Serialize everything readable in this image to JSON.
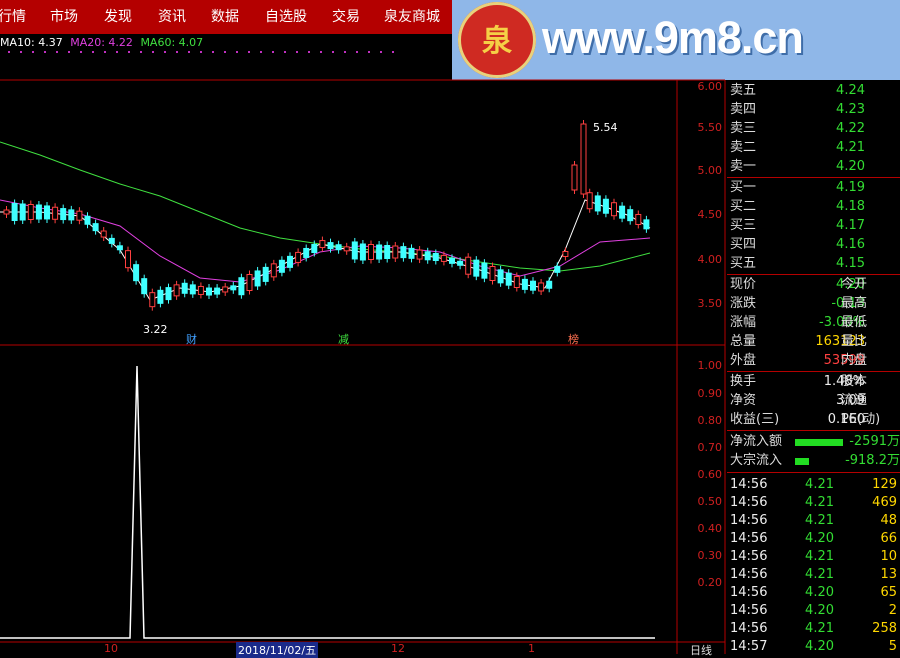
{
  "menu": [
    "行情",
    "市场",
    "发现",
    "资讯",
    "数据",
    "自选股",
    "交易",
    "泉友商城"
  ],
  "logo": {
    "badge": "泉",
    "url": "www.9m8.cn",
    "small": "www.9m8.cn"
  },
  "ma": {
    "ma10": "MA10: 4.37",
    "ma20": "MA20: 4.22",
    "ma60": "MA60: 4.07"
  },
  "price_axis": [
    "6.00",
    "5.50",
    "5.00",
    "4.50",
    "4.00",
    "3.50"
  ],
  "indicator_axis": [
    "1.00",
    "0.90",
    "0.80",
    "0.70",
    "0.60",
    "0.50",
    "0.40",
    "0.30",
    "0.20"
  ],
  "chart_labels": {
    "high": "5.54",
    "low": "3.22",
    "cai": "财",
    "jian": "减",
    "bang": "榜"
  },
  "date_axis": {
    "m10": "10",
    "date": "2018/11/02/五",
    "m12": "12",
    "m1": "1",
    "period": "日线"
  },
  "colors": {
    "up": "#ff4040",
    "down": "#40ffff",
    "ma10": "#ffffff",
    "ma20": "#e040e0",
    "ma60": "#40e040"
  },
  "chart_data": {
    "type": "line",
    "title": "",
    "series": [
      {
        "name": "MA10",
        "values": [
          4.37
        ]
      },
      {
        "name": "MA20",
        "values": [
          4.22
        ]
      },
      {
        "name": "MA60",
        "values": [
          4.07
        ]
      }
    ],
    "annotations": [
      "5.54",
      "3.22"
    ],
    "ylim": [
      3.3,
      6.0
    ]
  },
  "orderbook": {
    "asks": [
      {
        "label": "卖五",
        "price": "4.24"
      },
      {
        "label": "卖四",
        "price": "4.23"
      },
      {
        "label": "卖三",
        "price": "4.22"
      },
      {
        "label": "卖二",
        "price": "4.21"
      },
      {
        "label": "卖一",
        "price": "4.20"
      }
    ],
    "bids": [
      {
        "label": "买一",
        "price": "4.19"
      },
      {
        "label": "买二",
        "price": "4.18"
      },
      {
        "label": "买三",
        "price": "4.17"
      },
      {
        "label": "买四",
        "price": "4.16"
      },
      {
        "label": "买五",
        "price": "4.15"
      }
    ]
  },
  "stats": [
    {
      "l": "现价",
      "v": "4.20",
      "r": "今开"
    },
    {
      "l": "涨跌",
      "v": "-0.13",
      "r": "最高"
    },
    {
      "l": "涨幅",
      "v": "-3.00%",
      "r": "最低"
    },
    {
      "l": "总量",
      "v": "163123",
      "r": "量比"
    },
    {
      "l": "外盘",
      "v": "53599",
      "r": "内盘"
    },
    {
      "l": "换手",
      "v": "1.48%",
      "r": "股本"
    },
    {
      "l": "净资",
      "v": "3.09",
      "r": "流通"
    },
    {
      "l": "收益(三)",
      "v": "0.160",
      "r": "PE(动)"
    }
  ],
  "flows": [
    {
      "l": "净流入额",
      "v": "-2591万"
    },
    {
      "l": "大宗流入",
      "v": "-918.2万"
    }
  ],
  "trades": [
    {
      "t": "14:56",
      "p": "4.21",
      "v": "129"
    },
    {
      "t": "14:56",
      "p": "4.21",
      "v": "469"
    },
    {
      "t": "14:56",
      "p": "4.21",
      "v": "48"
    },
    {
      "t": "14:56",
      "p": "4.20",
      "v": "66"
    },
    {
      "t": "14:56",
      "p": "4.21",
      "v": "10"
    },
    {
      "t": "14:56",
      "p": "4.21",
      "v": "13"
    },
    {
      "t": "14:56",
      "p": "4.20",
      "v": "65"
    },
    {
      "t": "14:56",
      "p": "4.20",
      "v": "2"
    },
    {
      "t": "14:56",
      "p": "4.21",
      "v": "258"
    },
    {
      "t": "14:57",
      "p": "4.20",
      "v": "5"
    }
  ]
}
